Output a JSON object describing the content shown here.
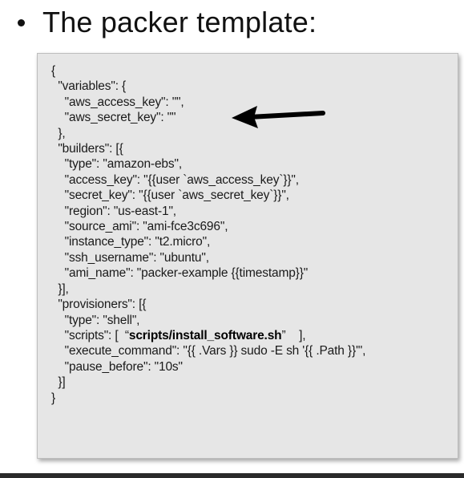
{
  "slide": {
    "bullet": "•",
    "title": "The packer template:"
  },
  "code": {
    "lines": [
      "{",
      "  \"variables\": {",
      "    \"aws_access_key\": \"\",",
      "    \"aws_secret_key\": \"\"",
      "  },",
      "  \"builders\": [{",
      "    \"type\": \"amazon-ebs\",",
      "    \"access_key\": \"{{user `aws_access_key`}}\",",
      "    \"secret_key\": \"{{user `aws_secret_key`}}\",",
      "    \"region\": \"us-east-1\",",
      "    \"source_ami\": \"ami-fce3c696\",",
      "    \"instance_type\": \"t2.micro\",",
      "    \"ssh_username\": \"ubuntu\",",
      "    \"ami_name\": \"packer-example {{timestamp}}\"",
      "  }],",
      "  \"provisioners\": [{",
      "    \"type\": \"shell\",",
      "    \"scripts\": [  “",
      "    \"execute_command\": \"{{ .Vars }} sudo -E sh '{{ .Path }}'\",",
      "    \"pause_before\": \"10s\"",
      "  }]",
      "}"
    ],
    "scripts_bold": "scripts/install_software.sh",
    "scripts_tail": "”    ],"
  },
  "annotation": {
    "arrow_icon": "left-arrow-icon",
    "arrow_color": "#000000"
  },
  "colors": {
    "code_bg": "#e6e6e6",
    "bottom_bar": "#2a2a2a"
  }
}
